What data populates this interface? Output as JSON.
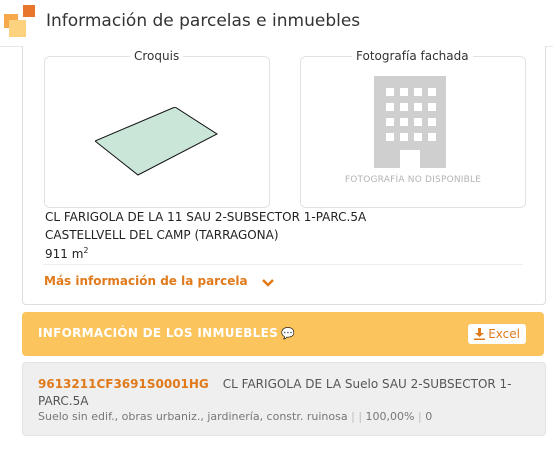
{
  "header": {
    "title": "Información de parcelas e inmuebles"
  },
  "parcela": {
    "croquis_label": "Croquis",
    "foto_label": "Fotografía fachada",
    "no_photo_text": "FOTOGRAFÍA NO DISPONIBLE",
    "address_line1": "CL FARIGOLA DE LA 11 SAU 2-SUBSECTOR 1-PARC.5A",
    "address_line2": "CASTELLVELL DEL CAMP (TARRAGONA)",
    "area_value": "911 m",
    "area_sup": "2",
    "more_info_link": "Más información de la parcela"
  },
  "inmuebles": {
    "title": "INFORMACIÓN DE LOS INMUEBLES",
    "excel_label": "Excel",
    "items": [
      {
        "ref": "9613211CF3691S0001HG",
        "address": "CL FARIGOLA DE LA Suelo SAU 2-SUBSECTOR 1-PARC.5A",
        "use": "Suelo sin edif., obras urbaniz., jardinería, constr. ruinosa",
        "sep1": "|",
        "sep2": "|",
        "participation": "100,00%",
        "sep3": "|",
        "count": "0"
      }
    ]
  },
  "colors": {
    "accent": "#e07a1b",
    "bar": "#fcc45c",
    "parcel_fill": "#c9e6d8"
  }
}
